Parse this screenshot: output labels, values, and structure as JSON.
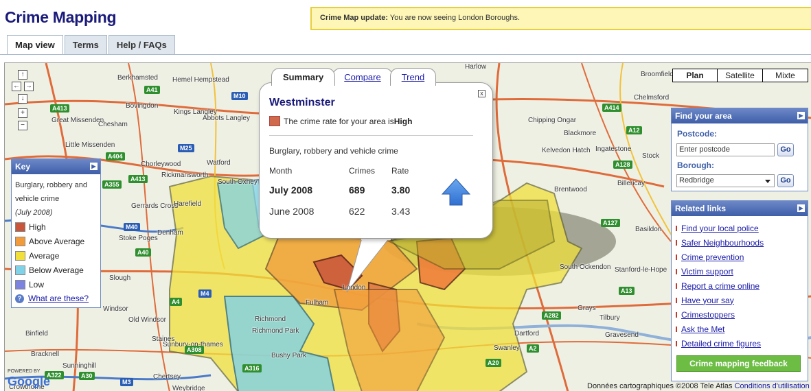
{
  "header": {
    "title": "Crime Mapping",
    "notice_bold": "Crime Map update:",
    "notice_text": " You are now seeing London Boroughs."
  },
  "tabs": [
    {
      "label": "Map view"
    },
    {
      "label": "Terms"
    },
    {
      "label": "Help / FAQs"
    }
  ],
  "map_type": [
    "Plan",
    "Satellite",
    "Mixte"
  ],
  "nav": {
    "up": "↑",
    "left": "←",
    "right": "→",
    "down": "↓",
    "zoom_in": "+",
    "zoom_out": "−"
  },
  "key": {
    "title": "Key",
    "description": "Burglary, robbery and vehicle crime",
    "period": "(July 2008)",
    "levels": [
      {
        "label": "High",
        "color": "#c9553b"
      },
      {
        "label": "Above Average",
        "color": "#f29b3b"
      },
      {
        "label": "Average",
        "color": "#f1e03c"
      },
      {
        "label": "Below Average",
        "color": "#7fd2e8"
      },
      {
        "label": "Low",
        "color": "#7b82e0"
      }
    ],
    "help_link": "What are these?"
  },
  "find": {
    "title": "Find your area",
    "postcode_label": "Postcode:",
    "postcode_value": "Enter postcode",
    "borough_label": "Borough:",
    "borough_value": "Redbridge",
    "go": "Go"
  },
  "related": {
    "title": "Related links",
    "links": [
      "Find your local police",
      "Safer Neighbourhoods",
      "Crime prevention",
      "Victim support",
      "Report a crime online",
      "Have your say",
      "Crimestoppers",
      "Ask the Met",
      "Detailed crime figures"
    ],
    "feedback": "Crime mapping feedback"
  },
  "popup": {
    "tabs": [
      "Summary",
      "Compare",
      "Trend"
    ],
    "title": "Westminster",
    "rate_text": "The crime rate for your area is ",
    "rate_level": "High",
    "subtitle": "Burglary, robbery and vehicle crime",
    "columns": [
      "Month",
      "Crimes",
      "Rate"
    ],
    "rows": [
      {
        "month": "July 2008",
        "crimes": "689",
        "rate": "3.80"
      },
      {
        "month": "June 2008",
        "crimes": "622",
        "rate": "3.43"
      }
    ],
    "close": "x"
  },
  "map_labels": {
    "towns": [
      "Harlow",
      "Hemel Hempstead",
      "Berkhamsted",
      "Chelmsford",
      "Broomfield",
      "Great Missenden",
      "Chesham",
      "Bovingdon",
      "Kings Langley",
      "Abbots Langley",
      "Chipping Ongar",
      "Blackmore",
      "Little Missenden",
      "Chorleywood",
      "Watford",
      "Kelvedon Hatch",
      "Ingatestone",
      "Stock",
      "Rickmansworth",
      "South Oxhey",
      "Billericay",
      "Brentwood",
      "Gerrards Cross",
      "Harefield",
      "Basildon",
      "Denham",
      "Stoke Poges",
      "South Ockendon",
      "Slough",
      "Stanford-le-Hope",
      "London",
      "Fulham",
      "Richmond",
      "Richmond Park",
      "Windsor",
      "Old Windsor",
      "Grays",
      "Tilbury",
      "Binfield",
      "Staines",
      "Dartford",
      "Gravesend",
      "Bracknell",
      "Sunbury-on-thames",
      "Swanley",
      "Sunninghill",
      "Bushy Park",
      "Chertsey",
      "Weybridge",
      "Crowthorne"
    ],
    "roads": [
      "A41",
      "A413",
      "M25",
      "M10",
      "A414",
      "A12",
      "A128",
      "A404",
      "A355",
      "A413",
      "M40",
      "A40",
      "A4",
      "A127",
      "A13",
      "A282",
      "A2",
      "A20",
      "A308",
      "M3",
      "A30",
      "A322",
      "A316",
      "M4"
    ]
  },
  "copyright": {
    "text": "Données cartographiques ©2008 Tele Atlas",
    "link": "Conditions d'utilisation"
  },
  "logo": {
    "powered": "POWERED BY",
    "google": "Google"
  }
}
